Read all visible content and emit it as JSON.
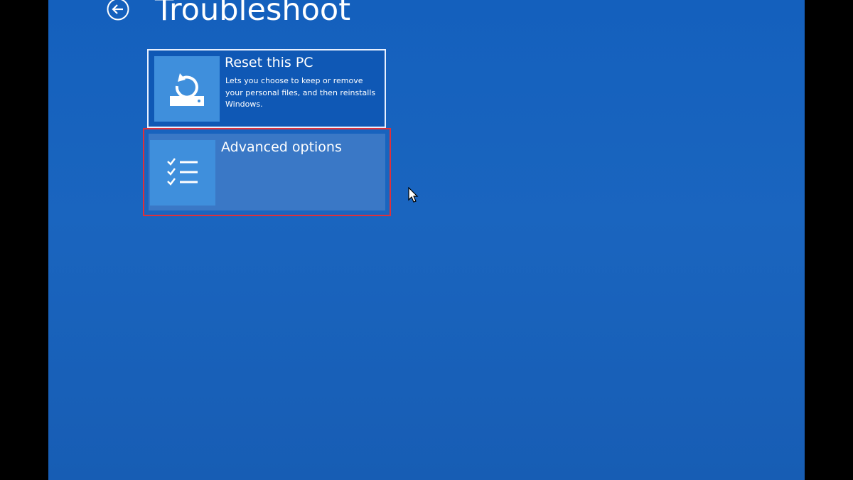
{
  "page": {
    "title": "Troubleshoot",
    "back_icon": "back-arrow-circle-icon"
  },
  "tiles": [
    {
      "title": "Reset this PC",
      "description": "Lets you choose to keep or remove your personal files, and then reinstalls Windows.",
      "icon": "reset-pc-icon",
      "state": "focused"
    },
    {
      "title": "Advanced options",
      "description": "",
      "icon": "checklist-icon",
      "state": "hover-highlighted"
    }
  ],
  "colors": {
    "background": "#1a65bf",
    "tile_icon": "#3f8fdc",
    "hover_tile": "#3a78c6",
    "highlight_border": "#e0303a",
    "text": "#ffffff"
  }
}
